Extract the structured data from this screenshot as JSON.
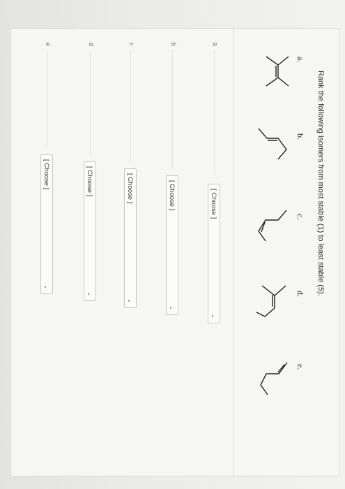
{
  "question": {
    "text": "Rank the following isomers from most stable (1) to least stable (5)."
  },
  "structures": [
    {
      "letter": "a."
    },
    {
      "letter": "b."
    },
    {
      "letter": "c."
    },
    {
      "letter": "d."
    },
    {
      "letter": "e."
    }
  ],
  "answers": [
    {
      "label": "a",
      "selected": "[ Choose ]"
    },
    {
      "label": "b",
      "selected": "[ Choose ]"
    },
    {
      "label": "c",
      "selected": "[ Choose ]"
    },
    {
      "label": "d",
      "selected": "[ Choose ]"
    },
    {
      "label": "e",
      "selected": "[ Choose ]"
    }
  ],
  "icons": {
    "dropdown": "chevron-down-icon"
  }
}
